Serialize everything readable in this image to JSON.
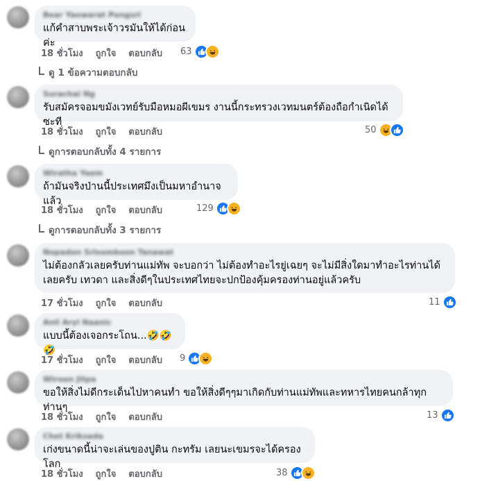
{
  "comments": [
    {
      "author": "Bear Yaowarat Pongsri",
      "text": [
        "แก้คำสาบพระเจ้าวรมันให้ได้ก่อนค่ะ"
      ],
      "time": "18 ชั่วโมง",
      "like": "ถูกใจ",
      "reply": "ตอบกลับ",
      "count": "63",
      "order": [
        "like",
        "haha"
      ],
      "replies": "ดู 1 ข้อความตอบกลับ"
    },
    {
      "author": "Surachai Ng",
      "text": [
        "รับสมัครจอมขมังเวทย์รับมือหมอผีเขมร งานนี้กระทรวงเวทมนตร์ต้องถือกำเนิดได้ซะที"
      ],
      "time": "18 ชั่วโมง",
      "like": "ถูกใจ",
      "reply": "ตอบกลับ",
      "count": "50",
      "order": [
        "haha",
        "like"
      ],
      "replies": "ดูการตอบกลับทั้ง 4 รายการ"
    },
    {
      "author": "Wiratha Yaem",
      "text": [
        "ถ้ามันจริงป่านนี้ประเทศมึงเป็นมหาอำนาจแล้ว"
      ],
      "time": "18 ชั่วโมง",
      "like": "ถูกใจ",
      "reply": "ตอบกลับ",
      "count": "129",
      "order": [
        "like",
        "haha"
      ],
      "replies": "ดูการตอบกลับทั้ง 3 รายการ"
    },
    {
      "author": "Nopadon Srisomboon Tanawat",
      "text": [
        "ไม่ต้องกลัวเลยครับท่านแม่ทัพ จะบอกว่า ไม่ต้องทำอะไรยู่เฉยๆ จะไม่มีสิ่งใดมาทำอะไรท่านได้",
        "เลยครับ เทวดา และสิ่งดีๆในประเทศไทยจะปกป้องคุ้มครองท่านอยู่แล้วครับ"
      ],
      "time": "17 ชั่วโมง",
      "like": "ถูกใจ",
      "reply": "ตอบกลับ",
      "count": "11",
      "order": [
        "like"
      ],
      "replies": ""
    },
    {
      "author": "Anil Aryl Naanic",
      "text": [
        "แบบนี้ต้องเจอกระโถน...🤣🤣🤣"
      ],
      "time": "17 ชั่วโมง",
      "like": "ถูกใจ",
      "reply": "ตอบกลับ",
      "count": "9",
      "order": [
        "like",
        "haha"
      ],
      "replies": ""
    },
    {
      "author": "Wiroon Jitpa",
      "text": [
        "ขอให้สิ่งไม่ดีกระเด็นไปหาคนทำ ขอให้สิ่งดีๆๆมาเกิดกับท่านแม่ทัพและทหารไทยคนกล้าทุกท่านๆ"
      ],
      "time": "18 ชั่วโมง",
      "like": "ถูกใจ",
      "reply": "ตอบกลับ",
      "count": "13",
      "order": [
        "like"
      ],
      "replies": ""
    },
    {
      "author": "Chet Kriksada",
      "text": [
        "เก่งขนาดนี้น่าจะเล่นของปูติน กะทรัม เลยนะเขมรจะได้ครองโลก"
      ],
      "time": "18 ชั่วโมง",
      "like": "ถูกใจ",
      "reply": "ตอบกลับ",
      "count": "38",
      "order": [
        "like",
        "haha"
      ],
      "replies": ""
    }
  ],
  "colors": {
    "like": "#1877f2",
    "haha": "#f7b125",
    "bubble": "#f0f2f5",
    "meta": "#65676b"
  },
  "icons": {
    "like": "thumbs-up-icon",
    "haha": "laughing-face-icon"
  }
}
